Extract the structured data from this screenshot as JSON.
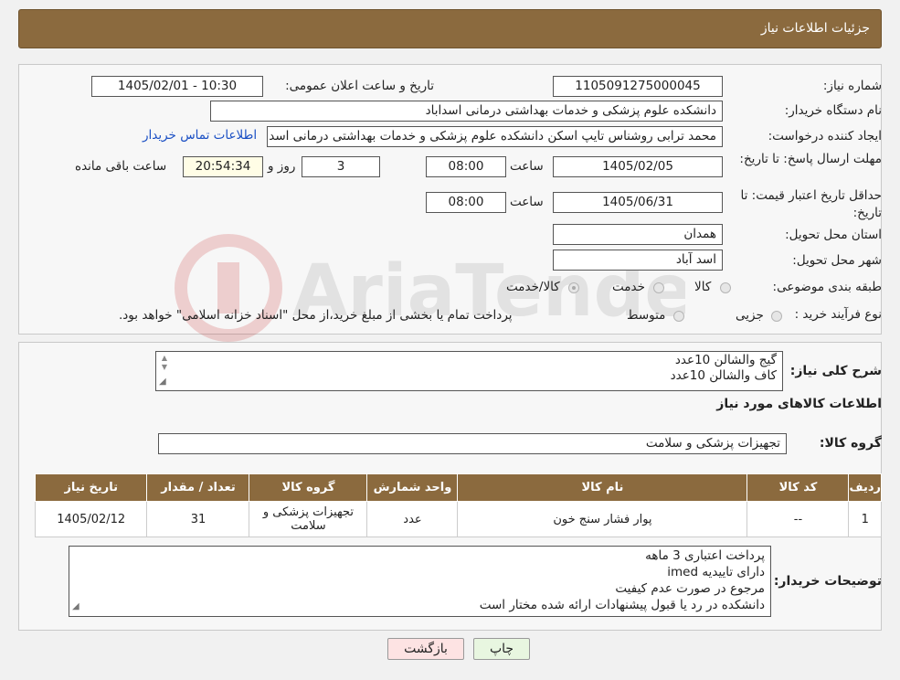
{
  "header": {
    "title": "جزئیات اطلاعات نیاز"
  },
  "fields": {
    "need_number_label": "شماره نیاز:",
    "need_number": "1105091275000045",
    "announce_label": "تاریخ و ساعت اعلان عمومی:",
    "announce_value": "1405/02/01 - 10:30",
    "buyer_label": "نام دستگاه خریدار:",
    "buyer_value": "دانشکده علوم پزشکی و خدمات بهداشتی درمانی اسداباد",
    "creator_label": "ایجاد کننده درخواست:",
    "creator_value": "محمد ترابی روشناس تایپ اسکن دانشکده علوم پزشکی و خدمات بهداشتی درمانی اسداباد",
    "contact_link": "اطلاعات تماس خریدار",
    "deadline_label": "مهلت ارسال پاسخ: تا تاریخ:",
    "deadline_date": "1405/02/05",
    "time_label": "ساعت",
    "deadline_time": "08:00",
    "days_value": "3",
    "days_label": "روز و",
    "remaining_time": "20:54:34",
    "remaining_label": "ساعت باقی مانده",
    "validity_label": "حداقل تاریخ اعتبار قیمت: تا تاریخ:",
    "validity_date": "1405/06/31",
    "validity_time": "08:00",
    "province_label": "استان محل تحویل:",
    "province_value": "همدان",
    "city_label": "شهر محل تحویل:",
    "city_value": "اسد آباد",
    "category_label": "طبقه بندی موضوعی:",
    "category_options": [
      "کالا",
      "خدمت",
      "کالا/خدمت"
    ],
    "process_label": "نوع فرآیند خرید :",
    "process_options": [
      "جزیی",
      "متوسط"
    ],
    "process_note": "پرداخت تمام یا بخشی از مبلغ خرید،از محل \"اسناد خزانه اسلامی\" خواهد بود."
  },
  "description": {
    "label": "شرح کلی نیاز:",
    "lines": [
      "گیج والشالن 10عدد",
      "کاف والشالن 10عدد"
    ]
  },
  "goods": {
    "section_title": "اطلاعات کالاهای مورد نیاز",
    "group_label": "گروه کالا:",
    "group_value": "تجهیزات پزشکی و سلامت"
  },
  "table": {
    "headers": [
      "ردیف",
      "کد کالا",
      "نام کالا",
      "واحد شمارش",
      "گروه کالا",
      "تعداد / مقدار",
      "تاریخ نیاز"
    ],
    "rows": [
      {
        "row": "1",
        "code": "--",
        "name": "پوار فشار سنج خون",
        "unit": "عدد",
        "group": "تجهیزات پزشکی و سلامت",
        "qty": "31",
        "date": "1405/02/12"
      }
    ]
  },
  "buyer_notes": {
    "label": "توضیحات خریدار:",
    "lines": [
      "پرداخت اعتباری 3 ماهه",
      "دارای تاییدیه imed",
      "مرجوع در صورت عدم کیفیت",
      "دانشکده در رد یا قبول پیشنهادات ارائه شده مختار است"
    ]
  },
  "buttons": {
    "print": "چاپ",
    "back": "بازگشت"
  },
  "watermark": {
    "text": "AriaTender.neT"
  },
  "colors": {
    "header": "#8b6a3e",
    "link": "#1a4fc4",
    "back_button": "#fde3e3",
    "print_button": "#e8f6e0"
  }
}
